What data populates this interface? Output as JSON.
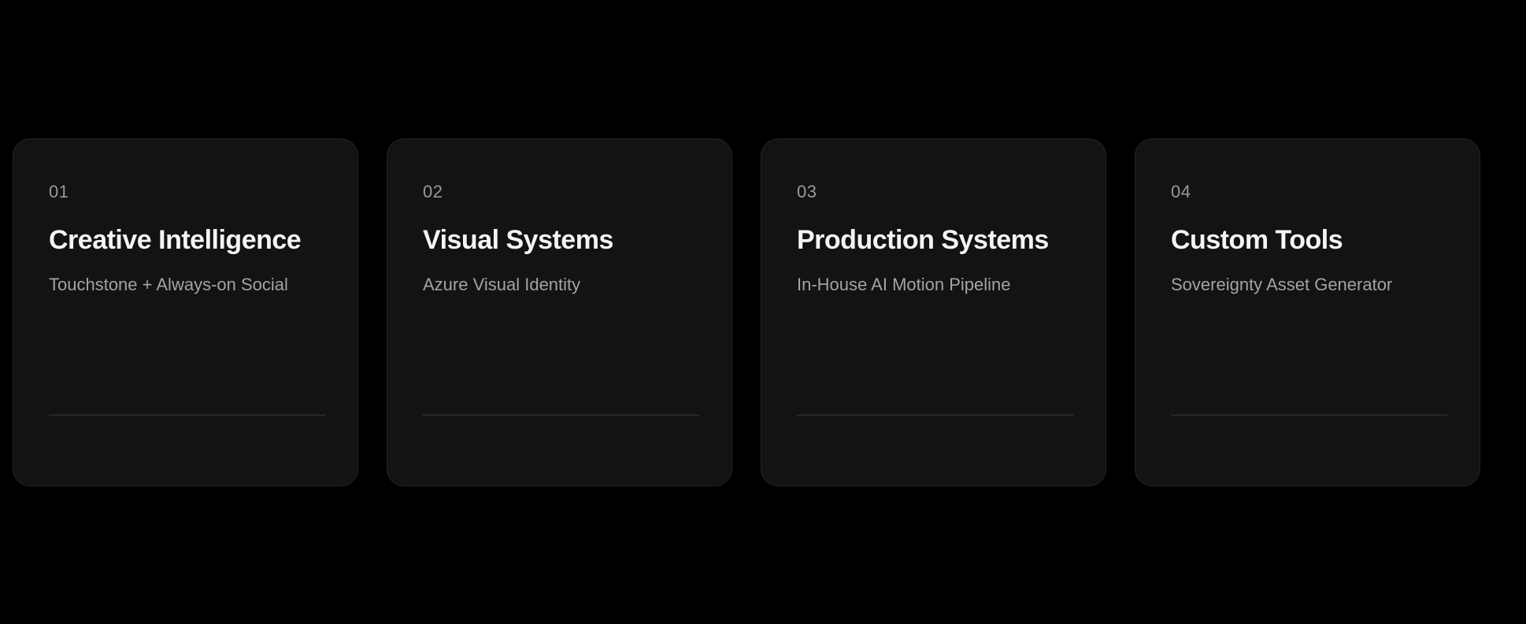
{
  "cards": [
    {
      "number": "01",
      "title": "Creative Intelligence",
      "subtitle": "Touchstone + Always-on Social"
    },
    {
      "number": "02",
      "title": "Visual Systems",
      "subtitle": "Azure Visual Identity"
    },
    {
      "number": "03",
      "title": "Production Systems",
      "subtitle": "In-House AI Motion Pipeline"
    },
    {
      "number": "04",
      "title": "Custom Tools",
      "subtitle": "Sovereignty Asset Generator"
    }
  ],
  "colors": {
    "background": "#000000",
    "card_background": "#131313",
    "card_border": "#242424",
    "title": "#f4f4f4",
    "subtitle": "#a3a3a3",
    "number": "#9a9a9a",
    "divider": "#3a3a3a"
  }
}
